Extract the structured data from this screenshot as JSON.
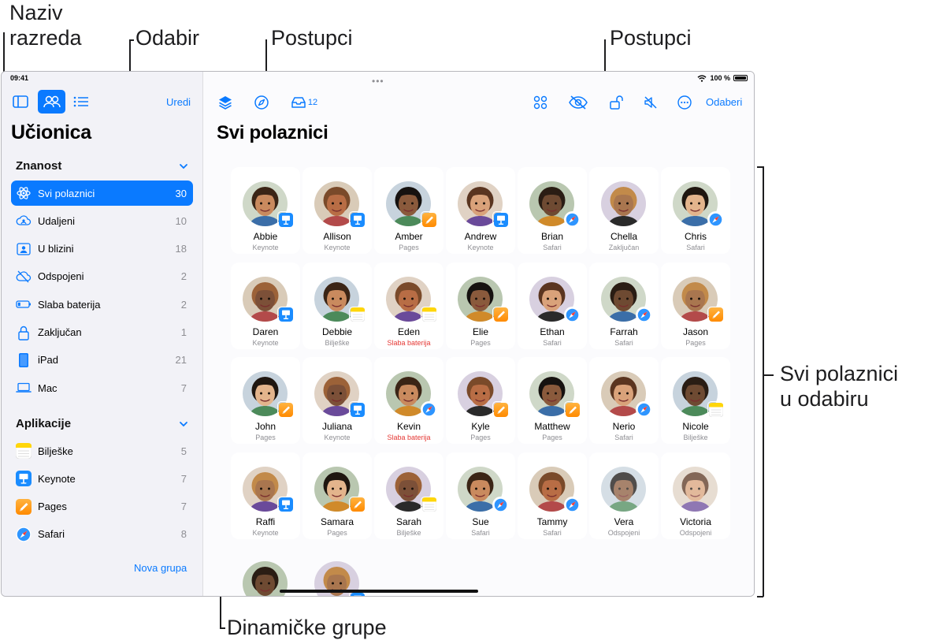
{
  "callouts": {
    "naziv": "Naziv\nrazreda",
    "naziv_line1": "Naziv",
    "naziv_line2": "razreda",
    "odabir": "Odabir",
    "postupci_left": "Postupci",
    "postupci_right": "Postupci",
    "svi_line1": "Svi polaznici",
    "svi_line2": "u odabiru",
    "dinamicke": "Dinamičke grupe"
  },
  "status": {
    "time": "09:41",
    "battery": "100 %"
  },
  "sidebar": {
    "edit_label": "Uredi",
    "title": "Učionica",
    "section1": "Znanost",
    "section2": "Aplikacije",
    "groups": [
      {
        "label": "Svi polaznici",
        "count": "30",
        "icon": "atom-icon"
      },
      {
        "label": "Udaljeni",
        "count": "10",
        "icon": "remote-icon"
      },
      {
        "label": "U blizini",
        "count": "18",
        "icon": "nearby-icon"
      },
      {
        "label": "Odspojeni",
        "count": "2",
        "icon": "cloud-off-icon"
      },
      {
        "label": "Slaba baterija",
        "count": "2",
        "icon": "battery-icon"
      },
      {
        "label": "Zaključan",
        "count": "1",
        "icon": "lock-icon"
      },
      {
        "label": "iPad",
        "count": "21",
        "icon": "ipad-icon"
      },
      {
        "label": "Mac",
        "count": "7",
        "icon": "laptop-icon"
      }
    ],
    "apps": [
      {
        "label": "Bilješke",
        "count": "5",
        "icon": "notes-icon"
      },
      {
        "label": "Keynote",
        "count": "7",
        "icon": "keynote-icon"
      },
      {
        "label": "Pages",
        "count": "7",
        "icon": "pages-icon"
      },
      {
        "label": "Safari",
        "count": "8",
        "icon": "safari-icon"
      }
    ],
    "new_group": "Nova grupa"
  },
  "toolbar": {
    "inbox_count": "12",
    "select_label": "Odaberi"
  },
  "main": {
    "title": "Svi polaznici"
  },
  "students": [
    {
      "name": "Abbie",
      "status": "Keynote",
      "app": "keynote"
    },
    {
      "name": "Allison",
      "status": "Keynote",
      "app": "keynote"
    },
    {
      "name": "Amber",
      "status": "Pages",
      "app": "pages"
    },
    {
      "name": "Andrew",
      "status": "Keynote",
      "app": "keynote"
    },
    {
      "name": "Brian",
      "status": "Safari",
      "app": "safari"
    },
    {
      "name": "Chella",
      "status": "Zaključan",
      "app": "none"
    },
    {
      "name": "Chris",
      "status": "Safari",
      "app": "safari"
    },
    {
      "name": "Daren",
      "status": "Keynote",
      "app": "keynote"
    },
    {
      "name": "Debbie",
      "status": "Bilješke",
      "app": "notes"
    },
    {
      "name": "Eden",
      "status": "Slaba baterija",
      "app": "notes",
      "warn": true
    },
    {
      "name": "Elie",
      "status": "Pages",
      "app": "pages"
    },
    {
      "name": "Ethan",
      "status": "Safari",
      "app": "safari"
    },
    {
      "name": "Farrah",
      "status": "Safari",
      "app": "safari"
    },
    {
      "name": "Jason",
      "status": "Pages",
      "app": "pages"
    },
    {
      "name": "John",
      "status": "Pages",
      "app": "pages"
    },
    {
      "name": "Juliana",
      "status": "Keynote",
      "app": "keynote"
    },
    {
      "name": "Kevin",
      "status": "Slaba baterija",
      "app": "safari",
      "warn": true
    },
    {
      "name": "Kyle",
      "status": "Pages",
      "app": "pages"
    },
    {
      "name": "Matthew",
      "status": "Pages",
      "app": "pages"
    },
    {
      "name": "Nerio",
      "status": "Safari",
      "app": "safari"
    },
    {
      "name": "Nicole",
      "status": "Bilješke",
      "app": "notes"
    },
    {
      "name": "Raffi",
      "status": "Keynote",
      "app": "keynote"
    },
    {
      "name": "Samara",
      "status": "Pages",
      "app": "pages"
    },
    {
      "name": "Sarah",
      "status": "Bilješke",
      "app": "notes"
    },
    {
      "name": "Sue",
      "status": "Safari",
      "app": "safari"
    },
    {
      "name": "Tammy",
      "status": "Safari",
      "app": "safari"
    },
    {
      "name": "Vera",
      "status": "Odspojeni",
      "app": "none",
      "offline": true
    },
    {
      "name": "Victoria",
      "status": "Odspojeni",
      "app": "none",
      "offline": true
    },
    {
      "name": "",
      "status": "",
      "app": "none"
    },
    {
      "name": "",
      "status": "",
      "app": "keynote"
    }
  ],
  "colors": {
    "accent": "#0a7aff",
    "warning": "#e53935",
    "keynote": "#1a8cff",
    "pages": "#ff9500",
    "notes": "#ffd60a",
    "avatar_palette": [
      "#c98a5e",
      "#b86d45",
      "#8a5a3c",
      "#d9a27a",
      "#6e4a32",
      "#a9764f",
      "#e3b48c",
      "#7c5038"
    ]
  }
}
